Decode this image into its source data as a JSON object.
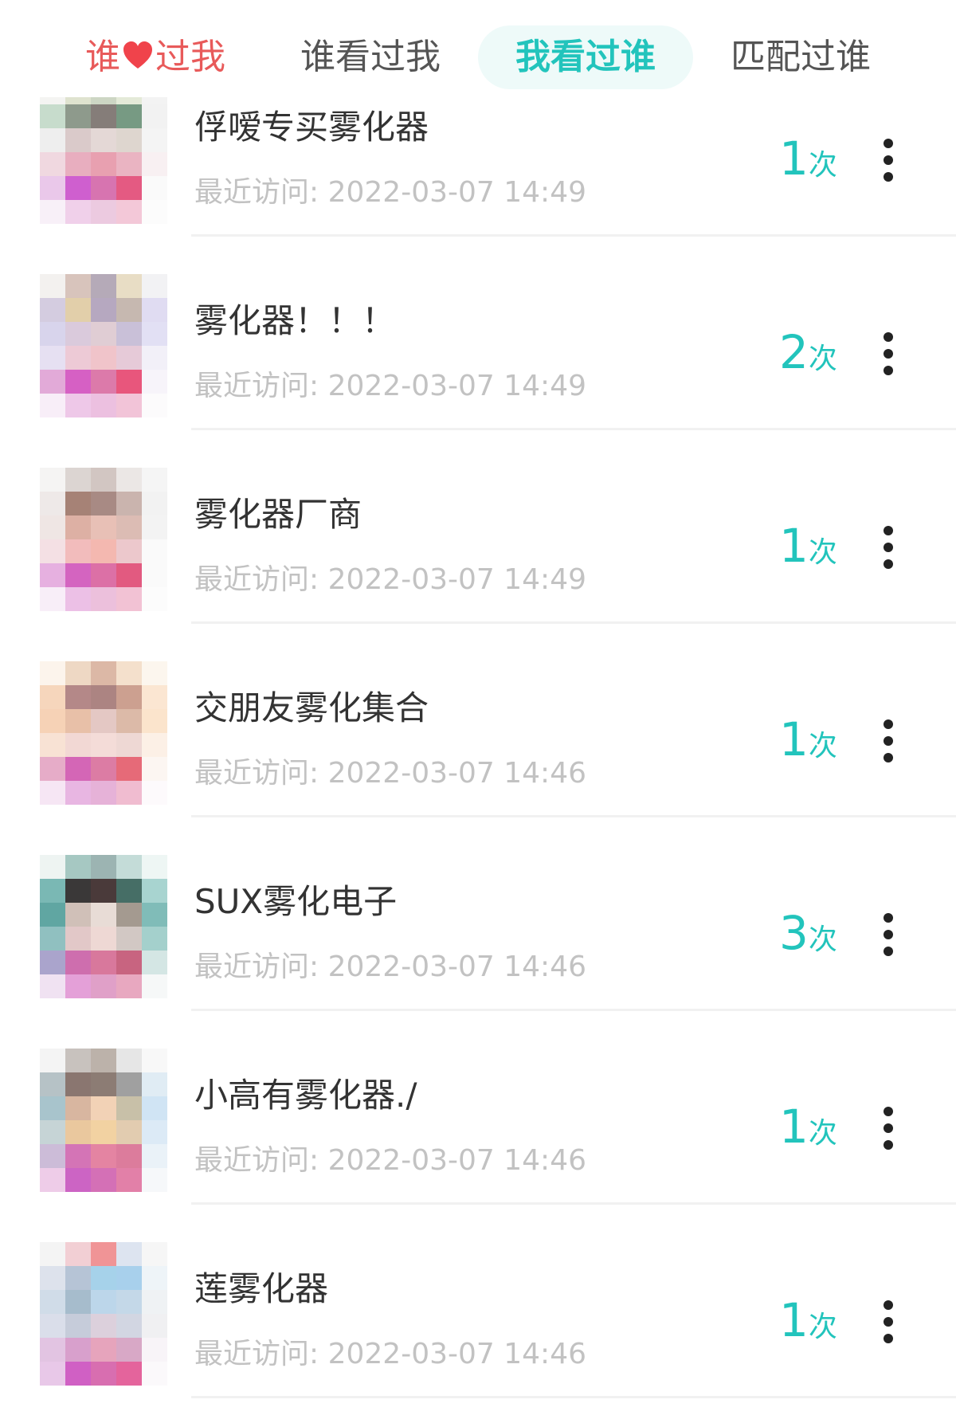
{
  "tabs": [
    {
      "label_left": "谁",
      "label_right": "过我",
      "icon": "heart-icon",
      "color": "#e85a5a"
    },
    {
      "label": "谁看过我"
    },
    {
      "label": "我看过谁",
      "active": true,
      "color": "#22c4bc"
    },
    {
      "label": "匹配过谁"
    }
  ],
  "recent_prefix": "最近访问:",
  "count_unit": "次",
  "items": [
    {
      "name": "俘嗳专买雾化器",
      "time": "2022-03-07 14:49",
      "count": "1"
    },
    {
      "name": "雾化器！！！",
      "time": "2022-03-07 14:49",
      "count": "2"
    },
    {
      "name": "雾化器厂商",
      "time": "2022-03-07 14:49",
      "count": "1"
    },
    {
      "name": "交朋友雾化集合",
      "time": "2022-03-07 14:46",
      "count": "1"
    },
    {
      "name": "SUX雾化电子",
      "time": "2022-03-07 14:46",
      "count": "3"
    },
    {
      "name": "小高有雾化器./",
      "time": "2022-03-07 14:46",
      "count": "1"
    },
    {
      "name": "莲雾化器",
      "time": "2022-03-07 14:46",
      "count": "1"
    }
  ],
  "accent_color": "#22c4bc",
  "item_icon": "more-vertical-icon"
}
